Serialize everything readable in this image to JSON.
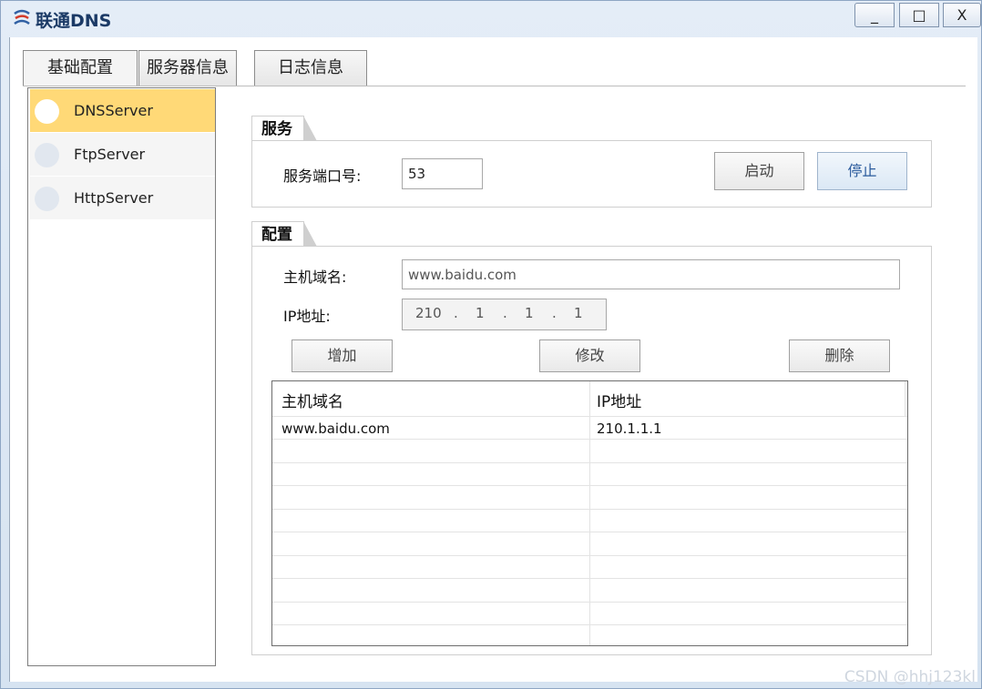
{
  "window": {
    "title": "联通DNS",
    "controls": {
      "minimize": "_",
      "maximize": "□",
      "close": "X"
    }
  },
  "tabs": [
    {
      "label": "基础配置",
      "active": true
    },
    {
      "label": "服务器信息",
      "active": false
    },
    {
      "label": "日志信息",
      "active": false
    }
  ],
  "sidebar": {
    "items": [
      {
        "label": "DNSServer",
        "active": true
      },
      {
        "label": "FtpServer",
        "active": false
      },
      {
        "label": "HttpServer",
        "active": false
      }
    ]
  },
  "service": {
    "title": "服务",
    "port_label": "服务端口号:",
    "port_value": "53",
    "start_label": "启动",
    "stop_label": "停止"
  },
  "config": {
    "title": "配置",
    "domain_label": "主机域名:",
    "domain_value": "www.baidu.com",
    "ip_label": "IP地址:",
    "ip_octets": [
      "210",
      "1",
      "1",
      "1"
    ],
    "ip_dot": ".",
    "add_label": "增加",
    "edit_label": "修改",
    "delete_label": "删除"
  },
  "table": {
    "headers": [
      "主机域名",
      "IP地址"
    ],
    "rows": [
      [
        "www.baidu.com",
        "210.1.1.1"
      ]
    ]
  },
  "watermark": "CSDN @hhj123kl",
  "colors": {
    "active_item": "#ffd977",
    "title_text": "#1b3a66",
    "stop_button_text": "#2a5a9c"
  }
}
